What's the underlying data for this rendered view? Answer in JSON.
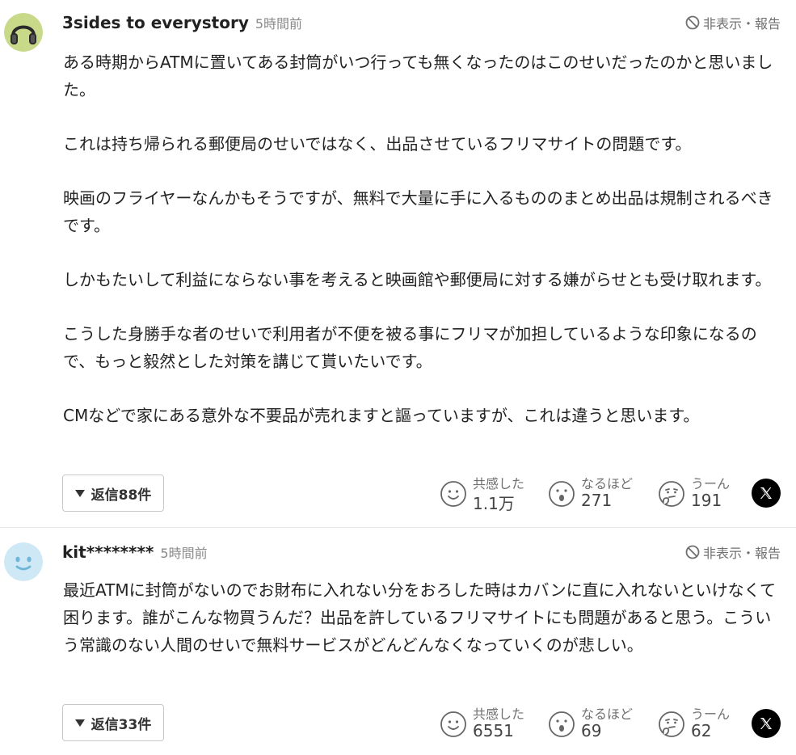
{
  "comments": [
    {
      "username": "3sides to everystory",
      "time": "5時間前",
      "hide_report": "非表示・報告",
      "paragraphs": [
        "ある時期からATMに置いてある封筒がいつ行っても無くなったのはこのせいだったのかと思いました。",
        "これは持ち帰られる郵便局のせいではなく、出品させているフリマサイトの問題です。",
        "映画のフライヤーなんかもそうですが、無料で大量に手に入るもののまとめ出品は規制されるべきです。",
        "しかもたいして利益にならない事を考えると映画館や郵便局に対する嫌がらせとも受け取れます。",
        "こうした身勝手な者のせいで利用者が不便を被る事にフリマが加担しているような印象になるので、もっと毅然とした対策を講じて貰いたいです。",
        "CMなどで家にある意外な不要品が売れますと謳っていますが、これは違うと思います。"
      ],
      "reply_label": "返信88件",
      "reactions": [
        {
          "label": "共感した",
          "count": "1.1万",
          "icon": "smile-icon"
        },
        {
          "label": "なるほど",
          "count": "271",
          "icon": "surprised-icon"
        },
        {
          "label": "うーん",
          "count": "191",
          "icon": "thinking-icon"
        }
      ],
      "avatar_icon": "headphones-avatar"
    },
    {
      "username": "kit********",
      "time": "5時間前",
      "hide_report": "非表示・報告",
      "paragraphs": [
        "最近ATMに封筒がないのでお財布に入れない分をおろした時はカバンに直に入れないといけなくて困ります。誰がこんな物買うんだ？出品を許しているフリマサイトにも問題があると思う。こういう常識のない人間のせいで無料サービスがどんどんなくなっていくのが悲しい。"
      ],
      "reply_label": "返信33件",
      "reactions": [
        {
          "label": "共感した",
          "count": "6551",
          "icon": "smile-icon"
        },
        {
          "label": "なるほど",
          "count": "69",
          "icon": "surprised-icon"
        },
        {
          "label": "うーん",
          "count": "62",
          "icon": "thinking-icon"
        }
      ],
      "avatar_icon": "default-face-avatar"
    }
  ],
  "colors": {
    "text": "#222222",
    "muted": "#707070",
    "avatar_blue": "#cfe8f5",
    "avatar_green": "#c9d98a"
  }
}
